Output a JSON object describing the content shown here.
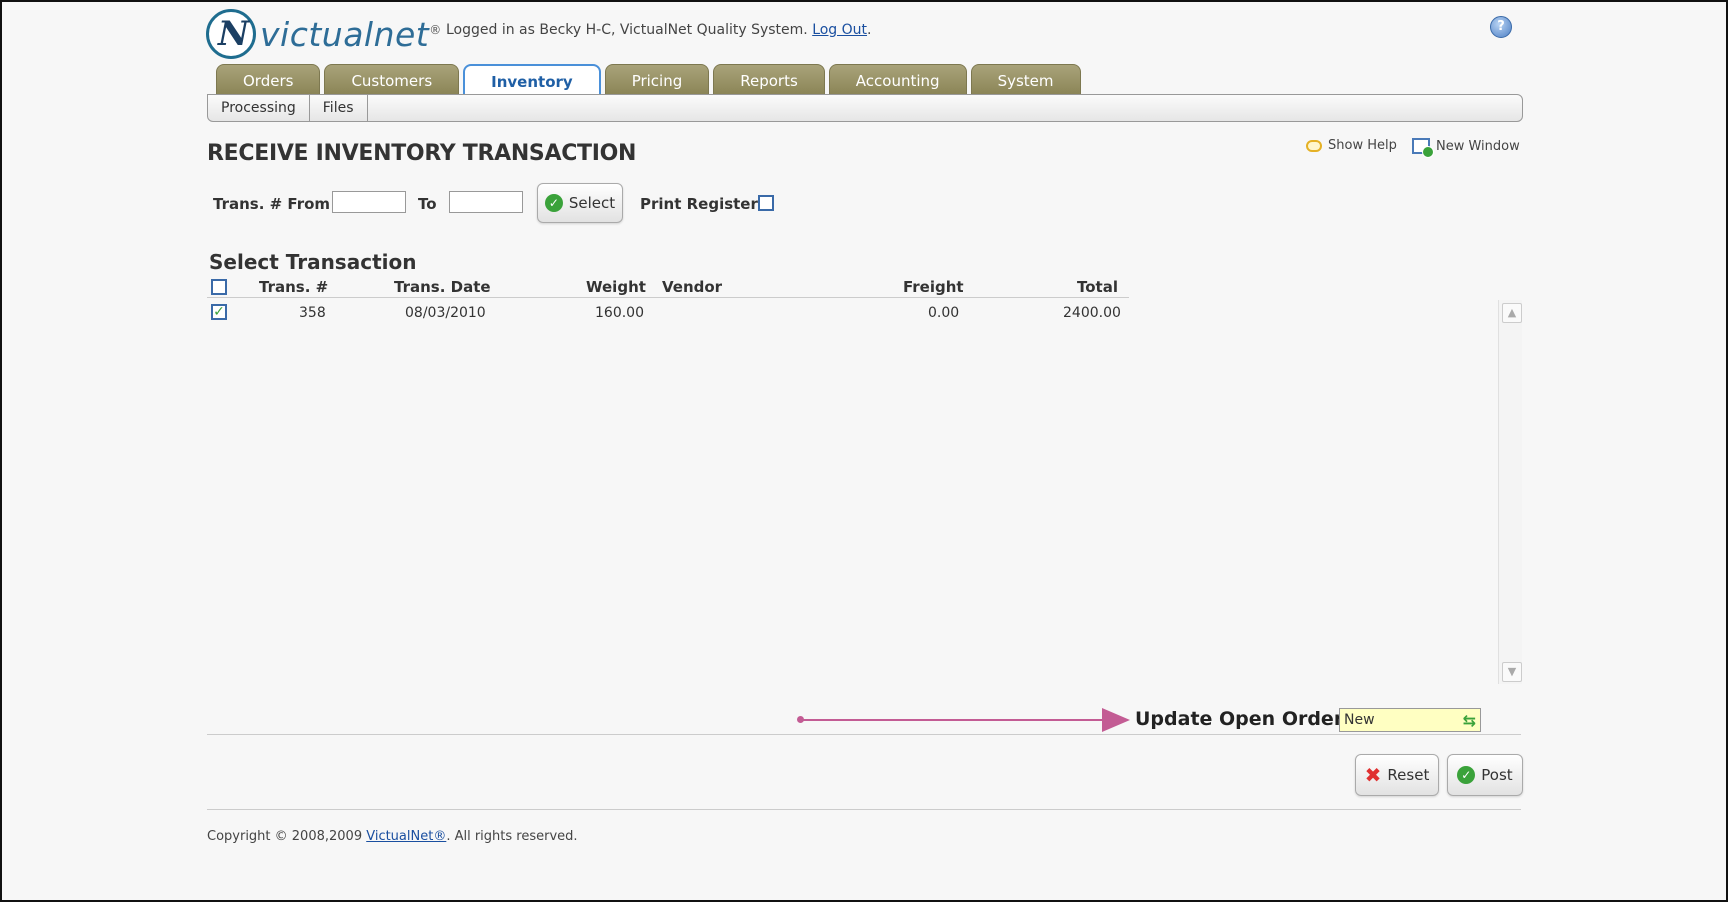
{
  "header": {
    "logo_mark": "N",
    "logo_text": "victualnet",
    "logo_reg": "®",
    "login_prefix": "Logged in as Becky H-C, VictualNet Quality System. ",
    "logout_link": "Log Out",
    "login_suffix": ".",
    "help_icon": "?"
  },
  "tabs": [
    {
      "label": "Orders"
    },
    {
      "label": "Customers"
    },
    {
      "label": "Inventory"
    },
    {
      "label": "Pricing"
    },
    {
      "label": "Reports"
    },
    {
      "label": "Accounting"
    },
    {
      "label": "System"
    }
  ],
  "subtabs": [
    {
      "label": "Processing"
    },
    {
      "label": "Files"
    }
  ],
  "page": {
    "title": "RECEIVE INVENTORY TRANSACTION",
    "show_help": "Show Help",
    "new_window": "New Window"
  },
  "filter": {
    "from_label": "Trans. # From",
    "from_value": "",
    "to_label": "To",
    "to_value": "",
    "select_button": "Select",
    "print_register_label": "Print Register"
  },
  "table": {
    "section_title": "Select Transaction",
    "columns": {
      "trans_no": "Trans. #",
      "trans_date": "Trans. Date",
      "weight": "Weight",
      "vendor": "Vendor",
      "freight": "Freight",
      "total": "Total"
    },
    "rows": [
      {
        "trans_no": "358",
        "trans_date": "08/03/2010",
        "weight": "160.00",
        "vendor": "",
        "freight": "0.00",
        "total": "2400.00"
      }
    ]
  },
  "update_orders": {
    "label": "Update Open Orders",
    "value": "New"
  },
  "actions": {
    "reset": "Reset",
    "post": "Post"
  },
  "footer": {
    "prefix": "Copyright © 2008,2009 ",
    "link": "VictualNet®",
    "suffix": ". All rights reserved."
  },
  "colors": {
    "tab": "#8b8557",
    "active_tab_text": "#1f5fa5",
    "annotation_arrow": "#c35c94",
    "update_field_bg": "#ffffc2"
  }
}
